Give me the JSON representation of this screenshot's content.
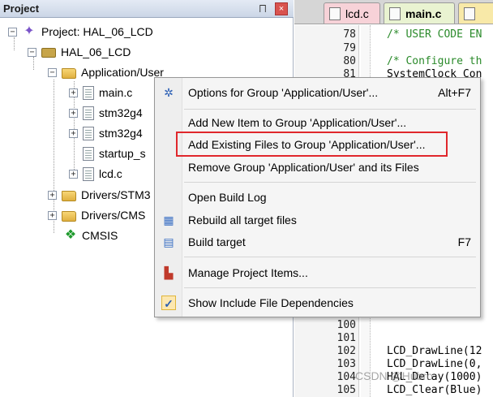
{
  "project_panel": {
    "title": "Project",
    "pin_glyph": "⨅",
    "close_glyph": "×",
    "tree": {
      "project": "Project: HAL_06_LCD",
      "target": "HAL_06_LCD",
      "group_app": "Application/User",
      "files": [
        "main.c",
        "stm32g4",
        "stm32g4",
        "startup_s",
        "lcd.c"
      ],
      "group_drivers_stm": "Drivers/STM3",
      "group_drivers_cms": "Drivers/CMS",
      "cmsis": "CMSIS"
    }
  },
  "editor": {
    "tabs": [
      "lcd.c",
      "main.c"
    ],
    "line_numbers_top": [
      "78",
      "79",
      "80",
      "81"
    ],
    "line_numbers_bottom": [
      "100",
      "101",
      "102",
      "103",
      "104",
      "105"
    ],
    "code_top": [
      "/* USER CODE EN",
      "",
      "/* Configure th",
      "SystemClock_Con"
    ],
    "code_bottom": [
      "",
      "",
      "LCD_DrawLine(12",
      "LCD_DrawLine(0,",
      "HAL_Delay(1000)",
      "LCD_Clear(Blue)"
    ],
    "watermark": "CSDN @Hubro"
  },
  "context_menu": {
    "items": [
      {
        "label": "Options for Group 'Application/User'...",
        "shortcut": "Alt+F7",
        "icon": "options-icon"
      },
      {
        "label": "Add New  Item to Group 'Application/User'...",
        "shortcut": "",
        "icon": ""
      },
      {
        "label": "Add Existing Files to Group 'Application/User'...",
        "shortcut": "",
        "icon": ""
      },
      {
        "label": "Remove Group 'Application/User' and its Files",
        "shortcut": "",
        "icon": ""
      },
      {
        "label": "Open Build Log",
        "shortcut": "",
        "icon": ""
      },
      {
        "label": "Rebuild all target files",
        "shortcut": "",
        "icon": "rebuild-icon"
      },
      {
        "label": "Build target",
        "shortcut": "F7",
        "icon": "build-icon"
      },
      {
        "label": "Manage Project Items...",
        "shortcut": "",
        "icon": "manage-items-icon"
      },
      {
        "label": "Show Include File Dependencies",
        "shortcut": "",
        "icon": "checkmark-icon"
      }
    ],
    "highlight_color": "#e0272c"
  }
}
